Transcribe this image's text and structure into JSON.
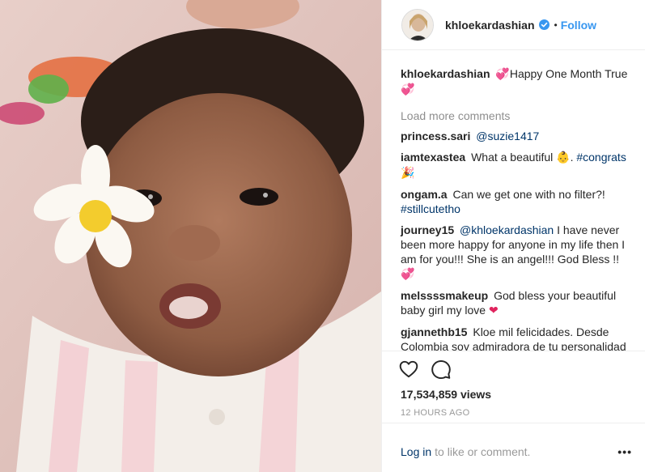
{
  "post": {
    "username": "khloekardashian",
    "separator": "•",
    "follow_label": "Follow",
    "caption": {
      "user": "khloekardashian",
      "text": "Happy One Month True"
    },
    "load_more_label": "Load more comments",
    "comments": [
      {
        "user": "princess.sari",
        "mention": "@suzie1417",
        "text": ""
      },
      {
        "user": "iamtexastea",
        "text": "What a beautiful",
        "hashtag": "#congrats"
      },
      {
        "user": "ongam.a",
        "text": "Can we get one with no filter?!",
        "hashtag": "#stillcutetho"
      },
      {
        "user": "journey15",
        "mention": "@khloekardashian",
        "text": "I have never been more happy for anyone in my life then I am for you!!! She is an angel!!! God Bless !!"
      },
      {
        "user": "melssssmakeup",
        "text": "God bless your beautiful baby girl my love"
      },
      {
        "user": "gjannethb15",
        "text": "Kloe mil felicidades. Desde Colombia soy admiradora de tu personalidad de tu sibceridad y hoy en dia de tu bebe. Dios las bendiga"
      }
    ],
    "views": "17,534,859 views",
    "time": "12 HOURS AGO",
    "login_label": "Log in",
    "login_suffix": "to like or comment.",
    "more_label": "•••",
    "icons": {
      "verified": "verified-badge-icon",
      "like": "heart-outline-icon",
      "comment": "speech-bubble-icon",
      "more": "more-options-icon"
    },
    "colors": {
      "link": "#003569",
      "follow": "#3897f0",
      "muted": "#999999"
    }
  }
}
